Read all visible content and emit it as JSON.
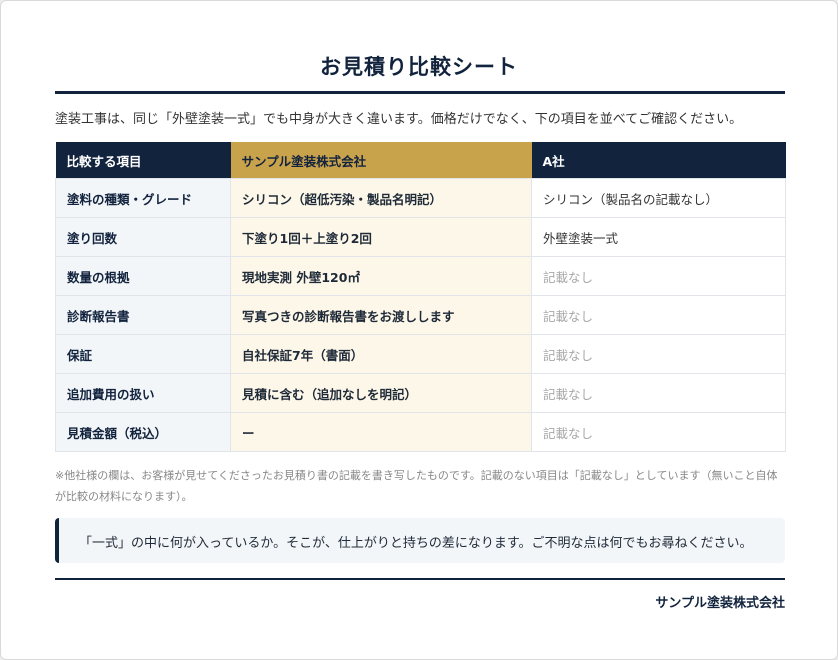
{
  "title": "お見積り比較シート",
  "intro": "塗装工事は、同じ「外壁塗装一式」でも中身が大きく違います。価格だけでなく、下の項目を並べてご確認ください。",
  "table": {
    "headers": [
      "比較する項目",
      "サンプル塗装株式会社",
      "A社"
    ],
    "rows": [
      {
        "item": "塗料の種類・グレード",
        "ours": "シリコン（超低汚染・製品名明記）",
        "other": "シリコン（製品名の記載なし）",
        "other_missing": false
      },
      {
        "item": "塗り回数",
        "ours": "下塗り1回＋上塗り2回",
        "other": "外壁塗装一式",
        "other_missing": false
      },
      {
        "item": "数量の根拠",
        "ours": "現地実測 外壁120㎡",
        "other": "記載なし",
        "other_missing": true
      },
      {
        "item": "診断報告書",
        "ours": "写真つきの診断報告書をお渡しします",
        "other": "記載なし",
        "other_missing": true
      },
      {
        "item": "保証",
        "ours": "自社保証7年（書面）",
        "other": "記載なし",
        "other_missing": true
      },
      {
        "item": "追加費用の扱い",
        "ours": "見積に含む（追加なしを明記）",
        "other": "記載なし",
        "other_missing": true
      },
      {
        "item": "見積金額（税込）",
        "ours": "ー",
        "other": "記載なし",
        "other_missing": true
      }
    ]
  },
  "note": "※他社様の欄は、お客様が見せてくださったお見積り書の記載を書き写したものです。記載のない項目は「記載なし」としています（無いこと自体が比較の材料になります）。",
  "callout": "「一式」の中に何が入っているか。そこが、仕上がりと持ちの差になります。ご不明な点は何でもお尋ねください。",
  "company": "サンプル塗装株式会社",
  "colors": {
    "navy": "#12233d",
    "gold": "#c9a24c",
    "ours_bg": "#fcf7e8",
    "item_bg": "#f3f6f9"
  }
}
